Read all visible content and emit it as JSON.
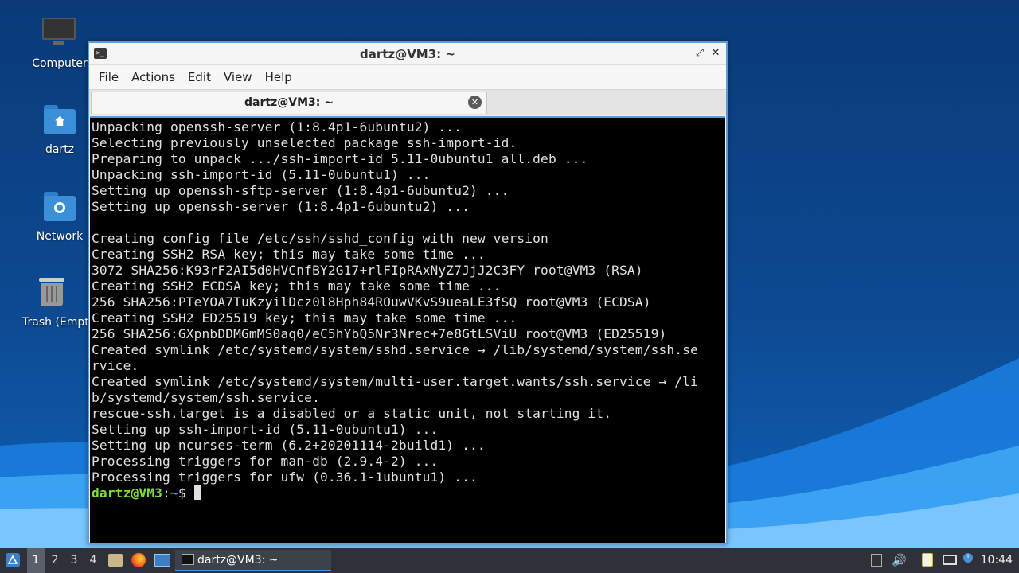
{
  "desktop": {
    "icons": [
      {
        "label": "Computer"
      },
      {
        "label": "dartz"
      },
      {
        "label": "Network"
      },
      {
        "label": "Trash (Empty)"
      }
    ]
  },
  "window": {
    "title": "dartz@VM3: ~",
    "menu": [
      "File",
      "Actions",
      "Edit",
      "View",
      "Help"
    ],
    "tab_title": "dartz@VM3: ~"
  },
  "terminal": {
    "lines": [
      "Unpacking openssh-server (1:8.4p1-6ubuntu2) ...",
      "Selecting previously unselected package ssh-import-id.",
      "Preparing to unpack .../ssh-import-id_5.11-0ubuntu1_all.deb ...",
      "Unpacking ssh-import-id (5.11-0ubuntu1) ...",
      "Setting up openssh-sftp-server (1:8.4p1-6ubuntu2) ...",
      "Setting up openssh-server (1:8.4p1-6ubuntu2) ...",
      "",
      "Creating config file /etc/ssh/sshd_config with new version",
      "Creating SSH2 RSA key; this may take some time ...",
      "3072 SHA256:K93rF2AI5d0HVCnfBY2G17+rlFIpRAxNyZ7JjJ2C3FY root@VM3 (RSA)",
      "Creating SSH2 ECDSA key; this may take some time ...",
      "256 SHA256:PTeYOA7TuKzyilDcz0l8Hph84ROuwVKvS9ueaLE3fSQ root@VM3 (ECDSA)",
      "Creating SSH2 ED25519 key; this may take some time ...",
      "256 SHA256:GXpnbDDMGmMS0aq0/eC5hYbQ5Nr3Nrec+7e8GtLSViU root@VM3 (ED25519)",
      "Created symlink /etc/systemd/system/sshd.service → /lib/systemd/system/ssh.se",
      "rvice.",
      "Created symlink /etc/systemd/system/multi-user.target.wants/ssh.service → /li",
      "b/systemd/system/ssh.service.",
      "rescue-ssh.target is a disabled or a static unit, not starting it.",
      "Setting up ssh-import-id (5.11-0ubuntu1) ...",
      "Setting up ncurses-term (6.2+20201114-2build1) ...",
      "Processing triggers for man-db (2.9.4-2) ...",
      "Processing triggers for ufw (0.36.1-1ubuntu1) ..."
    ],
    "prompt_user": "dartz@VM3",
    "prompt_sep": ":",
    "prompt_path": "~",
    "prompt_symbol": "$ "
  },
  "taskbar": {
    "workspaces": [
      "1",
      "2",
      "3",
      "4"
    ],
    "active_workspace": "1",
    "task_label": "dartz@VM3: ~",
    "clock": "10:44"
  },
  "colors": {
    "accent": "#4a90d9",
    "prompt_user": "#7fdc3a",
    "prompt_path": "#4f8cff"
  }
}
